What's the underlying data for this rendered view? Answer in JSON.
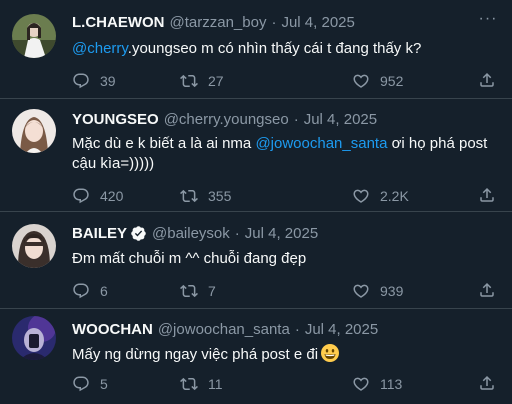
{
  "tweets": [
    {
      "name": "L.CHAEWON",
      "handle": "@tarzzan_boy",
      "separator": "·",
      "date": "Jul 4, 2025",
      "verified": false,
      "avatar_icon": "avatar-photo-icon",
      "text_parts": [
        {
          "type": "mention",
          "text": "@cherry"
        },
        {
          "type": "text",
          "text": ".youngseo m có nhìn thấy cái t đang thấy k?"
        }
      ],
      "counts": {
        "reply": "39",
        "retweet": "27",
        "like": "952"
      }
    },
    {
      "name": "YOUNGSEO",
      "handle": "@cherry.youngseo",
      "separator": "·",
      "date": "Jul 4, 2025",
      "verified": false,
      "avatar_icon": "avatar-photo-icon",
      "text_parts": [
        {
          "type": "text",
          "text": "Mặc dù e k biết a là ai nma "
        },
        {
          "type": "mention",
          "text": "@jowoochan_santa"
        },
        {
          "type": "text",
          "text": " ơi họ phá post cậu kìa=)))))"
        }
      ],
      "counts": {
        "reply": "420",
        "retweet": "355",
        "like": "2.2K"
      }
    },
    {
      "name": "BAILEY",
      "handle": "@baileysok",
      "separator": "·",
      "date": "Jul 4, 2025",
      "verified": true,
      "avatar_icon": "avatar-photo-icon",
      "text_parts": [
        {
          "type": "text",
          "text": "Đm mất chuỗi m ^^ chuỗi đang đẹp"
        }
      ],
      "counts": {
        "reply": "6",
        "retweet": "7",
        "like": "939"
      }
    },
    {
      "name": "WOOCHAN",
      "handle": "@jowoochan_santa",
      "separator": "·",
      "date": "Jul 4, 2025",
      "verified": false,
      "avatar_icon": "avatar-photo-icon",
      "text_parts": [
        {
          "type": "text",
          "text": "Mấy ng dừng ngay việc phá post e đi"
        }
      ],
      "emoji_icon": "grinning-face-emoji-icon",
      "counts": {
        "reply": "5",
        "retweet": "11",
        "like": "113"
      }
    }
  ],
  "colors": {
    "background": "#15202b",
    "text": "#f7f9f9",
    "muted": "#8b98a5",
    "accent": "#1d9bf0",
    "divider": "#38444d"
  },
  "icons": {
    "more": "more-horizontal-icon",
    "reply": "reply-bubble-icon",
    "retweet": "retweet-icon",
    "like": "heart-icon",
    "share": "share-upload-icon",
    "verified": "verified-badge-icon"
  }
}
